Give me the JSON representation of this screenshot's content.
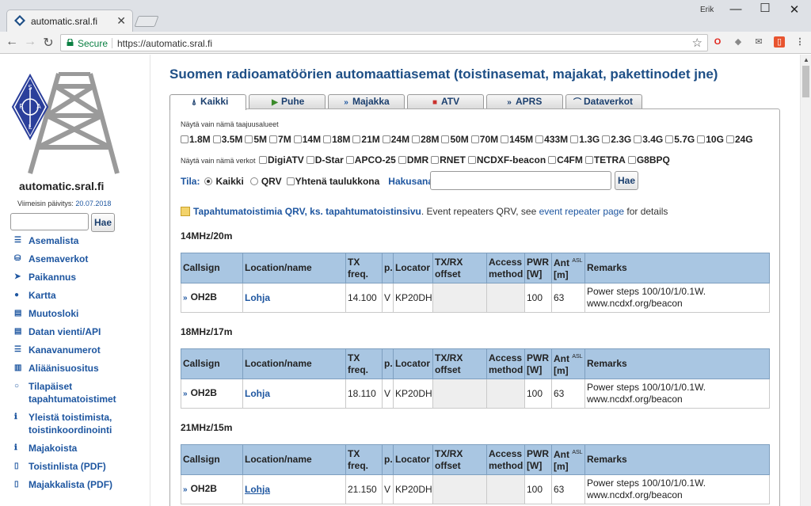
{
  "browser": {
    "tab_title": "automatic.sral.fi",
    "profile_name": "Erik",
    "secure_label": "Secure",
    "url": "https://automatic.sral.fi"
  },
  "sidebar": {
    "site_title": "automatic.sral.fi",
    "updated_label": "Viimeisin päivitys:",
    "updated_date": "20.07.2018",
    "search_button": "Hae",
    "menu": [
      {
        "icon": "list-icon",
        "label": "Asemalista"
      },
      {
        "icon": "network-icon",
        "label": "Asemaverkot"
      },
      {
        "icon": "location-arrow-icon",
        "label": "Paikannus"
      },
      {
        "icon": "globe-icon",
        "label": "Kartta"
      },
      {
        "icon": "history-icon",
        "label": "Muutosloki"
      },
      {
        "icon": "export-icon",
        "label": "Datan vienti/API"
      },
      {
        "icon": "channel-list-icon",
        "label": "Kanavanumerot"
      },
      {
        "icon": "bar-chart-icon",
        "label": "Aliäänisuositus"
      },
      {
        "icon": "circle-icon",
        "label": "Tilapäiset tapahtumatoistimet"
      },
      {
        "icon": "info-icon",
        "label": "Yleistä toistimista, toistinkoordinointi"
      },
      {
        "icon": "info-icon",
        "label": "Majakoista"
      },
      {
        "icon": "pdf-icon",
        "label": "Toistinlista (PDF)"
      },
      {
        "icon": "pdf-icon",
        "label": "Majakkalista (PDF)"
      }
    ]
  },
  "main": {
    "heading": "Suomen radioamatöörien automaattiasemat (toistinasemat, majakat, pakettinodet jne)",
    "tabs": [
      {
        "icon": "tower-icon",
        "label": "Kaikki"
      },
      {
        "icon": "repeater-icon",
        "label": "Puhe"
      },
      {
        "icon": "beacon-icon",
        "label": "Majakka"
      },
      {
        "icon": "camera-icon",
        "label": "ATV"
      },
      {
        "icon": "aprs-icon",
        "label": "APRS"
      },
      {
        "icon": "data-icon",
        "label": "Dataverkot"
      }
    ],
    "bands_label": "Näytä vain nämä taajuusalueet",
    "bands": [
      "1.8M",
      "3.5M",
      "5M",
      "7M",
      "14M",
      "18M",
      "21M",
      "24M",
      "28M",
      "50M",
      "70M",
      "145M",
      "433M",
      "1.3G",
      "2.3G",
      "3.4G",
      "5.7G",
      "10G",
      "24G"
    ],
    "networks_label": "Näytä vain nämä verkot",
    "networks": [
      "DigiATV",
      "D-Star",
      "APCO-25",
      "DMR",
      "RNET",
      "NCDXF-beacon",
      "C4FM",
      "TETRA",
      "G8BPQ"
    ],
    "tila_label": "Tila:",
    "tila_all": "Kaikki",
    "tila_qrv": "QRV",
    "single_table": "Yhtenä taulukkona",
    "search_label": "Hakusana:",
    "search_button": "Hae",
    "notice_link": "Tapahtumatoistimia QRV, ks. tapahtumatoistinsivu",
    "notice_text1": ". Event repeaters QRV, see",
    "notice_link2": "event repeater page",
    "notice_text2": "for details"
  },
  "table_headers": {
    "callsign": "Callsign",
    "location": "Location/name",
    "txfreq": "TX freq.",
    "p": "p.",
    "locator": "Locator",
    "offset": "TX/RX offset",
    "access": "Access method",
    "pwr": "PWR [W]",
    "ant": "Ant",
    "ant_asl": "ASL",
    "ant_unit": "[m]",
    "remarks": "Remarks"
  },
  "sections": [
    {
      "title": "14MHz/20m",
      "row": {
        "callsign": "OH2B",
        "location": "Lohja",
        "txfreq": "14.100",
        "p": "V",
        "locator": "KP20DH",
        "pwr": "100",
        "ant": "63",
        "remarks1": "Power steps 100/10/1/0.1W.",
        "remarks2": "www.ncdxf.org/beacon"
      }
    },
    {
      "title": "18MHz/17m",
      "row": {
        "callsign": "OH2B",
        "location": "Lohja",
        "txfreq": "18.110",
        "p": "V",
        "locator": "KP20DH",
        "pwr": "100",
        "ant": "63",
        "remarks1": "Power steps 100/10/1/0.1W.",
        "remarks2": "www.ncdxf.org/beacon"
      }
    },
    {
      "title": "21MHz/15m",
      "row": {
        "callsign": "OH2B",
        "location": "Lohja",
        "txfreq": "21.150",
        "p": "V",
        "locator": "KP20DH",
        "pwr": "100",
        "ant": "63",
        "remarks1": "Power steps 100/10/1/0.1W.",
        "remarks2": "www.ncdxf.org/beacon"
      }
    }
  ]
}
